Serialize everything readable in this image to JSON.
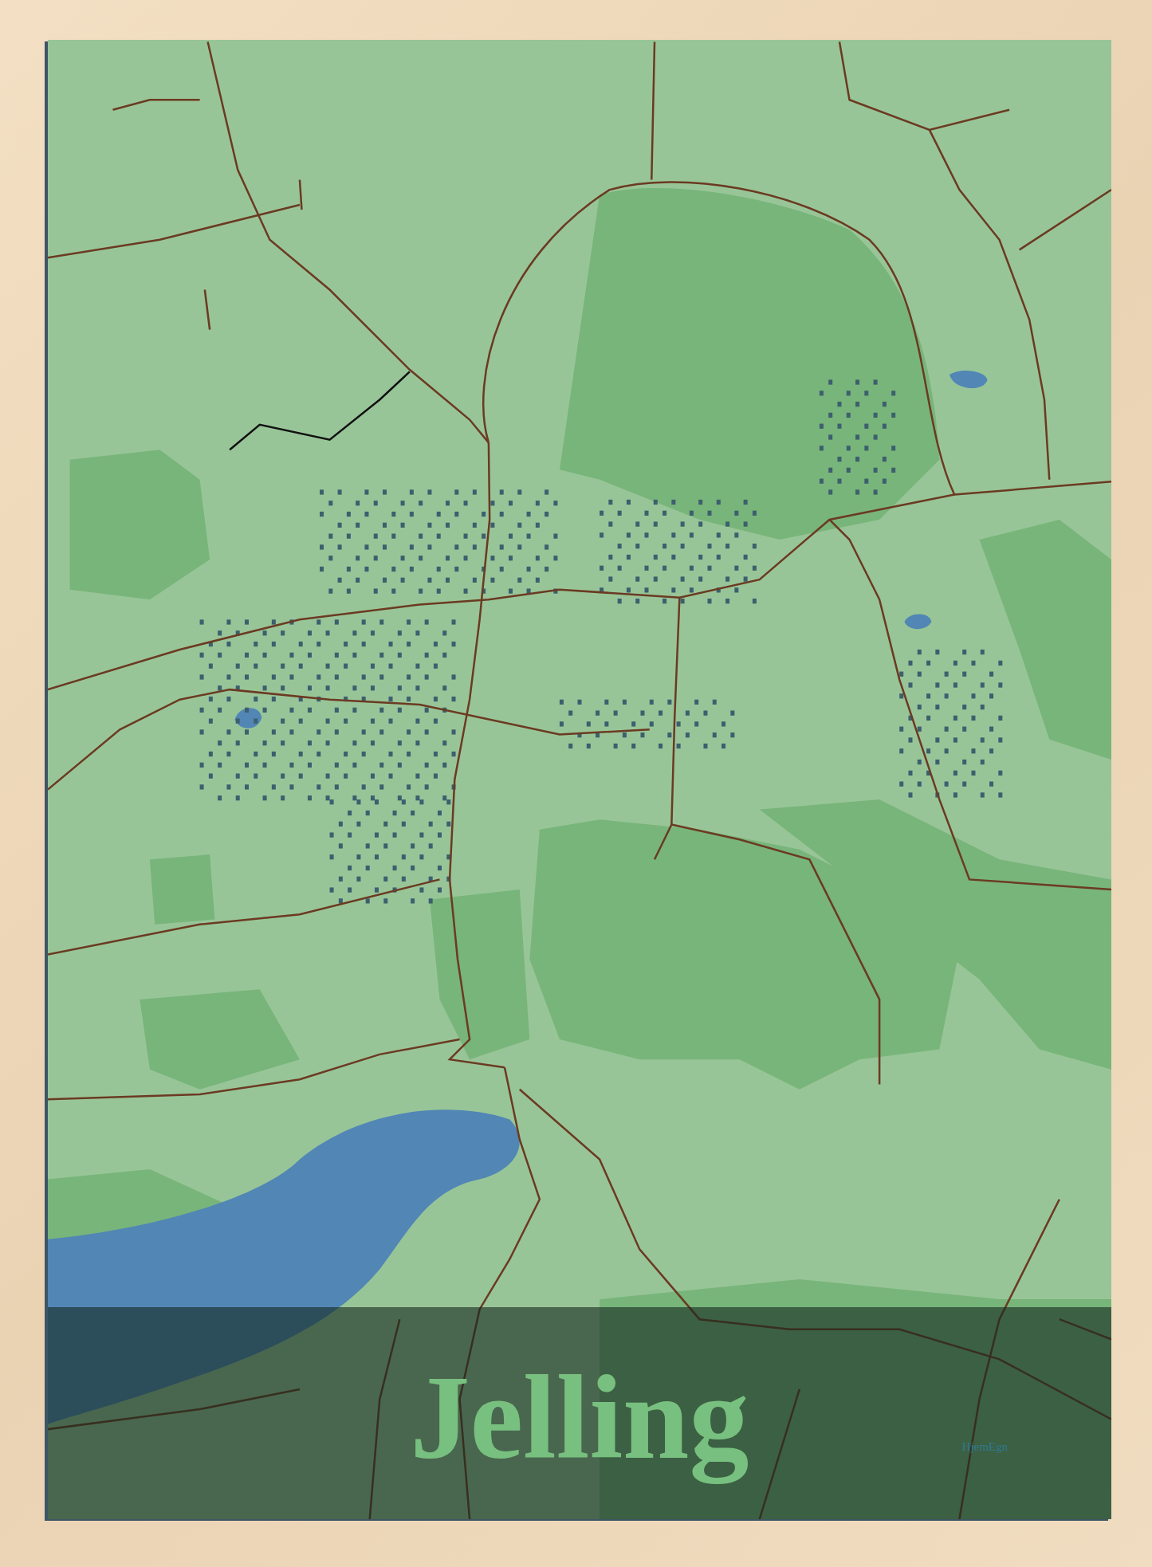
{
  "poster": {
    "title": "Jelling",
    "brand": "HjemEgn"
  }
}
